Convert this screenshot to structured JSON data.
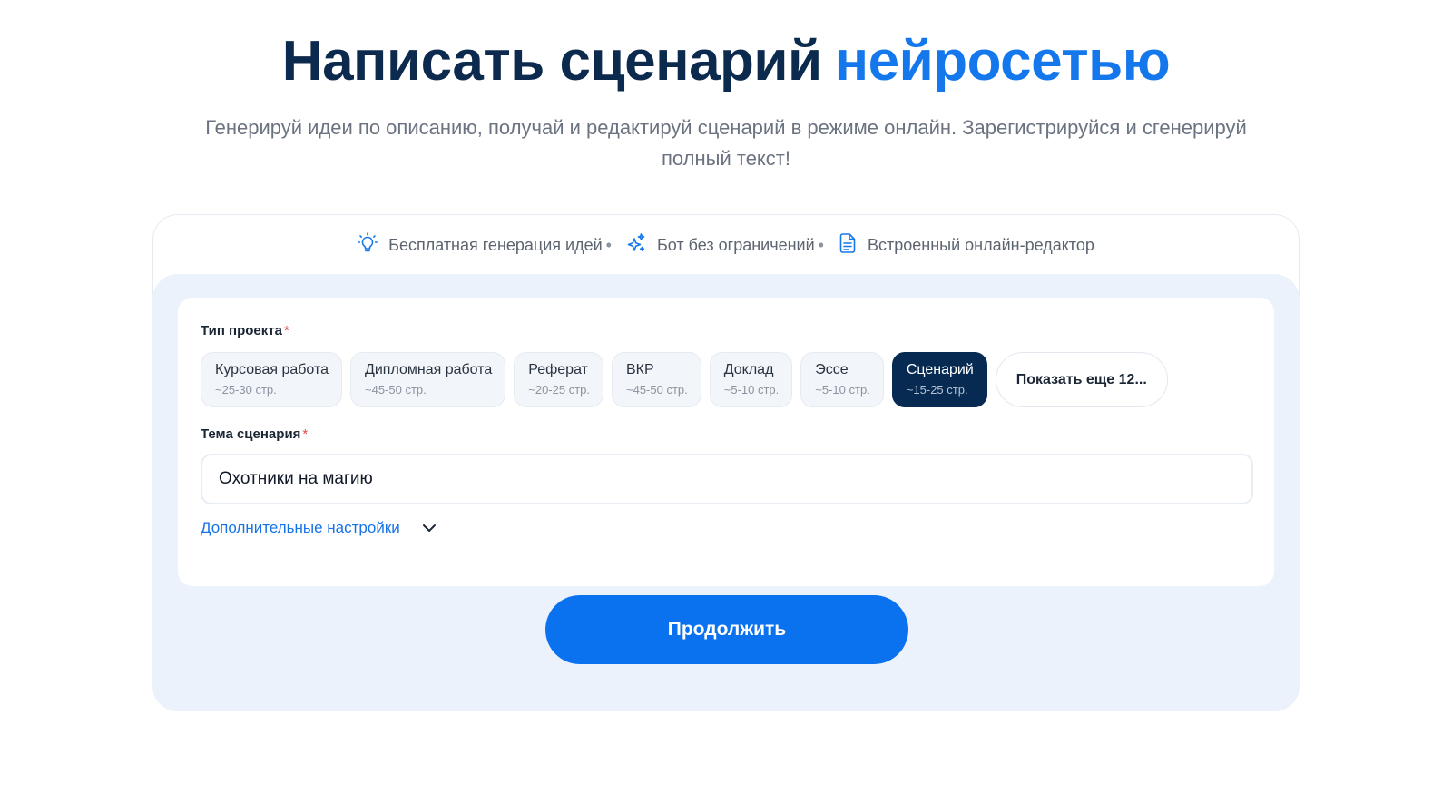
{
  "hero": {
    "title_main": "Написать сценарий",
    "title_accent": "нейросетью",
    "subtitle": "Генерируй идеи по описанию, получай и редактируй сценарий в режиме онлайн. Зарегистрируйся и сгенерируй полный текст!"
  },
  "features": [
    {
      "icon": "lightbulb-icon",
      "label": "Бесплатная генерация идей"
    },
    {
      "icon": "sparkle-icon",
      "label": "Бот без ограничений"
    },
    {
      "icon": "document-icon",
      "label": "Встроенный онлайн-редактор"
    }
  ],
  "feature_separator": "•",
  "form": {
    "project_type_label": "Тип проекта",
    "required_mark": "*",
    "project_types": [
      {
        "name": "Курсовая работа",
        "pages": "~25-30 стр.",
        "selected": false
      },
      {
        "name": "Дипломная работа",
        "pages": "~45-50 стр.",
        "selected": false
      },
      {
        "name": "Реферат",
        "pages": "~20-25 стр.",
        "selected": false
      },
      {
        "name": "ВКР",
        "pages": "~45-50 стр.",
        "selected": false
      },
      {
        "name": "Доклад",
        "pages": "~5-10 стр.",
        "selected": false
      },
      {
        "name": "Эссе",
        "pages": "~5-10 стр.",
        "selected": false
      },
      {
        "name": "Сценарий",
        "pages": "~15-25 стр.",
        "selected": true
      }
    ],
    "show_more_label": "Показать еще 12...",
    "topic_label": "Тема сценария",
    "topic_value": "Охотники на магию",
    "extra_settings_label": "Дополнительные настройки",
    "submit_label": "Продолжить"
  },
  "colors": {
    "accent": "#1577ec",
    "title": "#0c2a4d",
    "selected_chip": "#062a52",
    "panel_bg": "#ebf2fb",
    "button": "#0a72ee",
    "required": "#e5484d"
  }
}
